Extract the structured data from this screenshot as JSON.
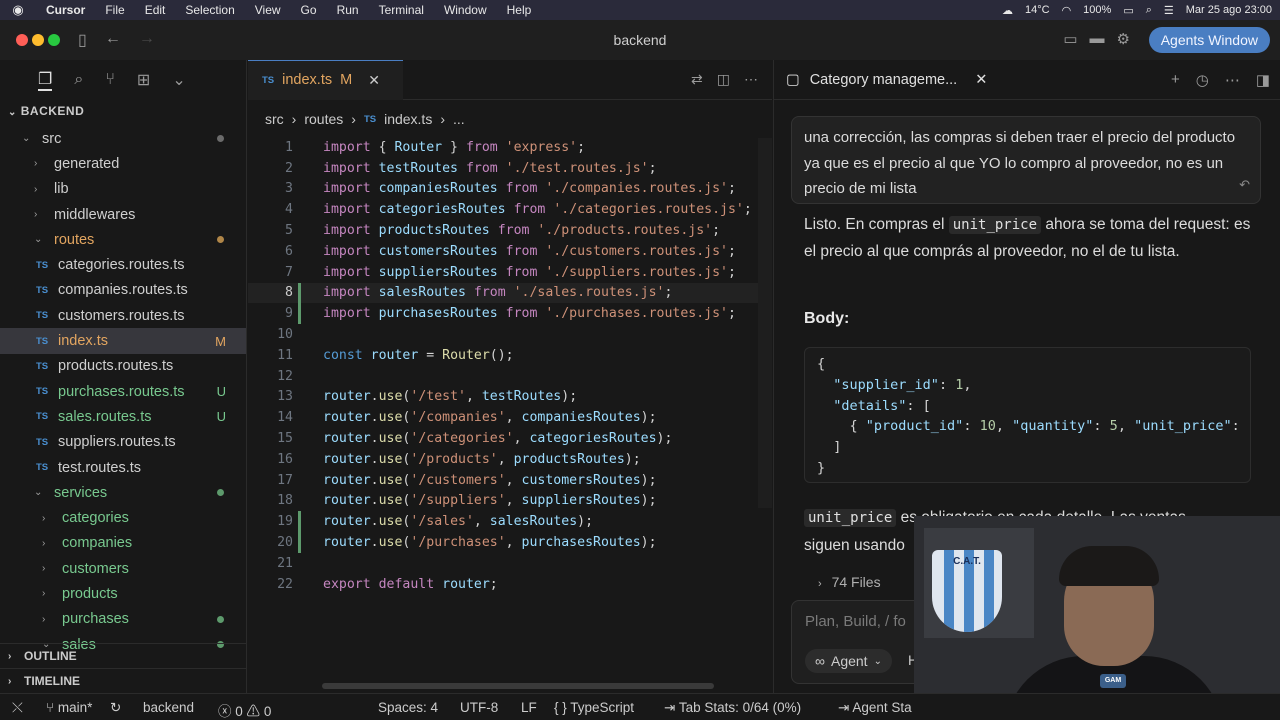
{
  "menubar": {
    "apple": "",
    "items": [
      "Cursor",
      "File",
      "Edit",
      "Selection",
      "View",
      "Go",
      "Run",
      "Terminal",
      "Window",
      "Help"
    ],
    "temperature": "14°C",
    "battery": "100%",
    "datetime": "Mar 25 ago  23:00"
  },
  "window": {
    "title": "backend",
    "agents_button": "Agents Window"
  },
  "sidebar": {
    "header": "BACKEND",
    "tree": [
      {
        "label": "src",
        "indent": 1,
        "chev": "⌄",
        "dot": "gray"
      },
      {
        "label": "generated",
        "indent": 2,
        "chev": "›"
      },
      {
        "label": "lib",
        "indent": 2,
        "chev": "›"
      },
      {
        "label": "middlewares",
        "indent": 2,
        "chev": "›"
      },
      {
        "label": "routes",
        "indent": 2,
        "chev": "⌄",
        "color": "orange",
        "dot": "orange"
      },
      {
        "label": "categories.routes.ts",
        "indent": 3,
        "ts": true
      },
      {
        "label": "companies.routes.ts",
        "indent": 3,
        "ts": true
      },
      {
        "label": "customers.routes.ts",
        "indent": 3,
        "ts": true
      },
      {
        "label": "index.ts",
        "indent": 3,
        "ts": true,
        "color": "orange",
        "badge": "M",
        "selected": true
      },
      {
        "label": "products.routes.ts",
        "indent": 3,
        "ts": true
      },
      {
        "label": "purchases.routes.ts",
        "indent": 3,
        "ts": true,
        "color": "green",
        "badge": "U"
      },
      {
        "label": "sales.routes.ts",
        "indent": 3,
        "ts": true,
        "color": "green",
        "badge": "U"
      },
      {
        "label": "suppliers.routes.ts",
        "indent": 3,
        "ts": true
      },
      {
        "label": "test.routes.ts",
        "indent": 3,
        "ts": true
      },
      {
        "label": "services",
        "indent": 2,
        "chev": "⌄",
        "color": "green",
        "dot": "green"
      },
      {
        "label": "categories",
        "indent": 3,
        "chev": "›",
        "color": "green"
      },
      {
        "label": "companies",
        "indent": 3,
        "chev": "›",
        "color": "green"
      },
      {
        "label": "customers",
        "indent": 3,
        "chev": "›",
        "color": "green"
      },
      {
        "label": "products",
        "indent": 3,
        "chev": "›",
        "color": "green"
      },
      {
        "label": "purchases",
        "indent": 3,
        "chev": "›",
        "color": "green",
        "dot": "green"
      },
      {
        "label": "sales",
        "indent": 3,
        "chev": "⌄",
        "color": "green",
        "dot": "green"
      }
    ],
    "outline": "OUTLINE",
    "timeline": "TIMELINE"
  },
  "editor": {
    "tab": {
      "icon": "TS",
      "label": "index.ts",
      "status": "M"
    },
    "breadcrumb": {
      "part1": "src",
      "part2": "routes",
      "icon": "TS",
      "file": "index.ts",
      "more": "..."
    },
    "current_line": 8,
    "lines": [
      [
        [
          "kw",
          "import"
        ],
        [
          "p",
          " { "
        ],
        [
          "var",
          "Router"
        ],
        [
          "p",
          " } "
        ],
        [
          "kw",
          "from"
        ],
        [
          "p",
          " "
        ],
        [
          "str",
          "'express'"
        ],
        [
          "p",
          ";"
        ]
      ],
      [
        [
          "kw",
          "import"
        ],
        [
          "p",
          " "
        ],
        [
          "var",
          "testRoutes"
        ],
        [
          "p",
          " "
        ],
        [
          "kw",
          "from"
        ],
        [
          "p",
          " "
        ],
        [
          "str",
          "'./test.routes.js'"
        ],
        [
          "p",
          ";"
        ]
      ],
      [
        [
          "kw",
          "import"
        ],
        [
          "p",
          " "
        ],
        [
          "var",
          "companiesRoutes"
        ],
        [
          "p",
          " "
        ],
        [
          "kw",
          "from"
        ],
        [
          "p",
          " "
        ],
        [
          "str",
          "'./companies.routes.js'"
        ],
        [
          "p",
          ";"
        ]
      ],
      [
        [
          "kw",
          "import"
        ],
        [
          "p",
          " "
        ],
        [
          "var",
          "categoriesRoutes"
        ],
        [
          "p",
          " "
        ],
        [
          "kw",
          "from"
        ],
        [
          "p",
          " "
        ],
        [
          "str",
          "'./categories.routes.js'"
        ],
        [
          "p",
          ";"
        ]
      ],
      [
        [
          "kw",
          "import"
        ],
        [
          "p",
          " "
        ],
        [
          "var",
          "productsRoutes"
        ],
        [
          "p",
          " "
        ],
        [
          "kw",
          "from"
        ],
        [
          "p",
          " "
        ],
        [
          "str",
          "'./products.routes.js'"
        ],
        [
          "p",
          ";"
        ]
      ],
      [
        [
          "kw",
          "import"
        ],
        [
          "p",
          " "
        ],
        [
          "var",
          "customersRoutes"
        ],
        [
          "p",
          " "
        ],
        [
          "kw",
          "from"
        ],
        [
          "p",
          " "
        ],
        [
          "str",
          "'./customers.routes.js'"
        ],
        [
          "p",
          ";"
        ]
      ],
      [
        [
          "kw",
          "import"
        ],
        [
          "p",
          " "
        ],
        [
          "var",
          "suppliersRoutes"
        ],
        [
          "p",
          " "
        ],
        [
          "kw",
          "from"
        ],
        [
          "p",
          " "
        ],
        [
          "str",
          "'./suppliers.routes.js'"
        ],
        [
          "p",
          ";"
        ]
      ],
      [
        [
          "kw",
          "import"
        ],
        [
          "p",
          " "
        ],
        [
          "var",
          "salesRoutes"
        ],
        [
          "p",
          " "
        ],
        [
          "kw",
          "from"
        ],
        [
          "p",
          " "
        ],
        [
          "str",
          "'./sales.routes.js'"
        ],
        [
          "p",
          ";"
        ]
      ],
      [
        [
          "kw",
          "import"
        ],
        [
          "p",
          " "
        ],
        [
          "var",
          "purchasesRoutes"
        ],
        [
          "p",
          " "
        ],
        [
          "kw",
          "from"
        ],
        [
          "p",
          " "
        ],
        [
          "str",
          "'./purchases.routes.js'"
        ],
        [
          "p",
          ";"
        ]
      ],
      [],
      [
        [
          "kb",
          "const"
        ],
        [
          "p",
          " "
        ],
        [
          "var",
          "router"
        ],
        [
          "p",
          " = "
        ],
        [
          "fn",
          "Router"
        ],
        [
          "p",
          "();"
        ]
      ],
      [],
      [
        [
          "var",
          "router"
        ],
        [
          "p",
          "."
        ],
        [
          "fn",
          "use"
        ],
        [
          "p",
          "("
        ],
        [
          "str",
          "'/test'"
        ],
        [
          "p",
          ", "
        ],
        [
          "var",
          "testRoutes"
        ],
        [
          "p",
          ");"
        ]
      ],
      [
        [
          "var",
          "router"
        ],
        [
          "p",
          "."
        ],
        [
          "fn",
          "use"
        ],
        [
          "p",
          "("
        ],
        [
          "str",
          "'/companies'"
        ],
        [
          "p",
          ", "
        ],
        [
          "var",
          "companiesRoutes"
        ],
        [
          "p",
          ");"
        ]
      ],
      [
        [
          "var",
          "router"
        ],
        [
          "p",
          "."
        ],
        [
          "fn",
          "use"
        ],
        [
          "p",
          "("
        ],
        [
          "str",
          "'/categories'"
        ],
        [
          "p",
          ", "
        ],
        [
          "var",
          "categoriesRoutes"
        ],
        [
          "p",
          ");"
        ]
      ],
      [
        [
          "var",
          "router"
        ],
        [
          "p",
          "."
        ],
        [
          "fn",
          "use"
        ],
        [
          "p",
          "("
        ],
        [
          "str",
          "'/products'"
        ],
        [
          "p",
          ", "
        ],
        [
          "var",
          "productsRoutes"
        ],
        [
          "p",
          ");"
        ]
      ],
      [
        [
          "var",
          "router"
        ],
        [
          "p",
          "."
        ],
        [
          "fn",
          "use"
        ],
        [
          "p",
          "("
        ],
        [
          "str",
          "'/customers'"
        ],
        [
          "p",
          ", "
        ],
        [
          "var",
          "customersRoutes"
        ],
        [
          "p",
          ");"
        ]
      ],
      [
        [
          "var",
          "router"
        ],
        [
          "p",
          "."
        ],
        [
          "fn",
          "use"
        ],
        [
          "p",
          "("
        ],
        [
          "str",
          "'/suppliers'"
        ],
        [
          "p",
          ", "
        ],
        [
          "var",
          "suppliersRoutes"
        ],
        [
          "p",
          ");"
        ]
      ],
      [
        [
          "var",
          "router"
        ],
        [
          "p",
          "."
        ],
        [
          "fn",
          "use"
        ],
        [
          "p",
          "("
        ],
        [
          "str",
          "'/sales'"
        ],
        [
          "p",
          ", "
        ],
        [
          "var",
          "salesRoutes"
        ],
        [
          "p",
          ");"
        ]
      ],
      [
        [
          "var",
          "router"
        ],
        [
          "p",
          "."
        ],
        [
          "fn",
          "use"
        ],
        [
          "p",
          "("
        ],
        [
          "str",
          "'/purchases'"
        ],
        [
          "p",
          ", "
        ],
        [
          "var",
          "purchasesRoutes"
        ],
        [
          "p",
          ");"
        ]
      ],
      [],
      [
        [
          "kw",
          "export"
        ],
        [
          "p",
          " "
        ],
        [
          "kw",
          "default"
        ],
        [
          "p",
          " "
        ],
        [
          "var",
          "router"
        ],
        [
          "p",
          ";"
        ]
      ]
    ],
    "modified_lines": [
      8,
      9,
      19,
      20
    ]
  },
  "chat": {
    "title": "Category manageme...",
    "user_message": "una corrección, las compras si deben traer el precio del producto ya que es el precio al que YO lo compro al proveedor, no es un precio de mi lista",
    "reply_pre": "Listo. En compras el ",
    "reply_code": "unit_price",
    "reply_post": " ahora se toma del request: es el precio al que comprás al proveedor, no el de tu lista.",
    "body_label": "Body:",
    "json_lines": [
      [
        [
          "p",
          "{"
        ]
      ],
      [
        [
          "p",
          "  "
        ],
        [
          "k",
          "\"supplier_id\""
        ],
        [
          "p",
          ": "
        ],
        [
          "n",
          "1"
        ],
        [
          "p",
          ","
        ]
      ],
      [
        [
          "p",
          "  "
        ],
        [
          "k",
          "\"details\""
        ],
        [
          "p",
          ": ["
        ]
      ],
      [
        [
          "p",
          "    { "
        ],
        [
          "k",
          "\"product_id\""
        ],
        [
          "p",
          ": "
        ],
        [
          "n",
          "10"
        ],
        [
          "p",
          ", "
        ],
        [
          "k",
          "\"quantity\""
        ],
        [
          "p",
          ": "
        ],
        [
          "n",
          "5"
        ],
        [
          "p",
          ", "
        ],
        [
          "k",
          "\"unit_price\""
        ],
        [
          "p",
          ":"
        ]
      ],
      [
        [
          "p",
          "  ]"
        ]
      ],
      [
        [
          "p",
          "}"
        ]
      ]
    ],
    "after_code": "unit_price",
    "after_text_1": " es obligatorio en cada detalle. Las ventas",
    "after_text_2": "siguen usando",
    "files": "74 Files",
    "input_placeholder": "Plan, Build, / fo",
    "agent_label": "Agent",
    "mode_initial": "H"
  },
  "statusbar": {
    "branch": "main*",
    "project": "backend",
    "errors": "0",
    "warnings": "0",
    "spaces": "Spaces: 4",
    "encoding": "UTF-8",
    "eol": "LF",
    "language": "TypeScript",
    "tabstats": "Tab Stats: 0/64 (0%)",
    "agent": "Agent Sta"
  },
  "colors": {
    "accent": "#4a7ec2",
    "modified": "#e2a560",
    "untracked": "#78c98f"
  }
}
